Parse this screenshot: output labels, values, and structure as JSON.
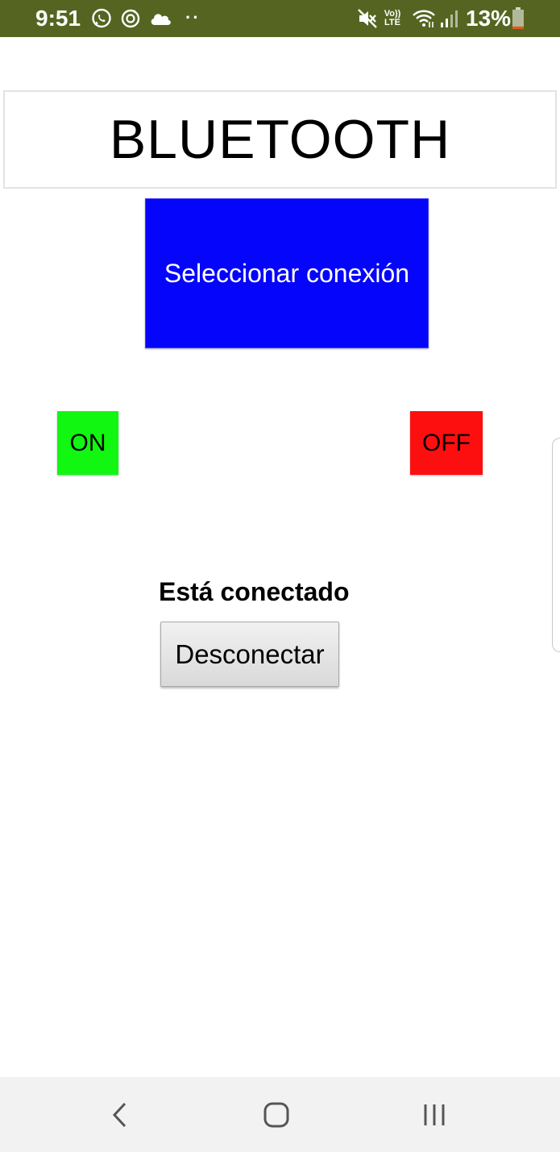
{
  "status_bar": {
    "time": "9:51",
    "left_icons": [
      "whatsapp-icon",
      "sync-icon",
      "cloud-icon"
    ],
    "dots": "··",
    "right_icons": [
      "mute-icon",
      "volte-icon",
      "wifi-icon",
      "signal-icon"
    ],
    "volte_top": "Vo))",
    "volte_bottom": "LTE",
    "battery_percent": "13%",
    "battery_level": 0.13,
    "background_color": "#556521",
    "battery_color": "#e05a1c"
  },
  "title": "BLUETOOTH",
  "select_button": {
    "label": "Seleccionar conexión",
    "color": "#0505fb"
  },
  "on_button": {
    "label": "ON",
    "color": "#11f711"
  },
  "off_button": {
    "label": "OFF",
    "color": "#fd0f0f"
  },
  "connection": {
    "status_text": "Está conectado",
    "disconnect_label": "Desconectar"
  },
  "nav_bar": {
    "items": [
      "back-icon",
      "home-icon",
      "recents-icon"
    ]
  }
}
